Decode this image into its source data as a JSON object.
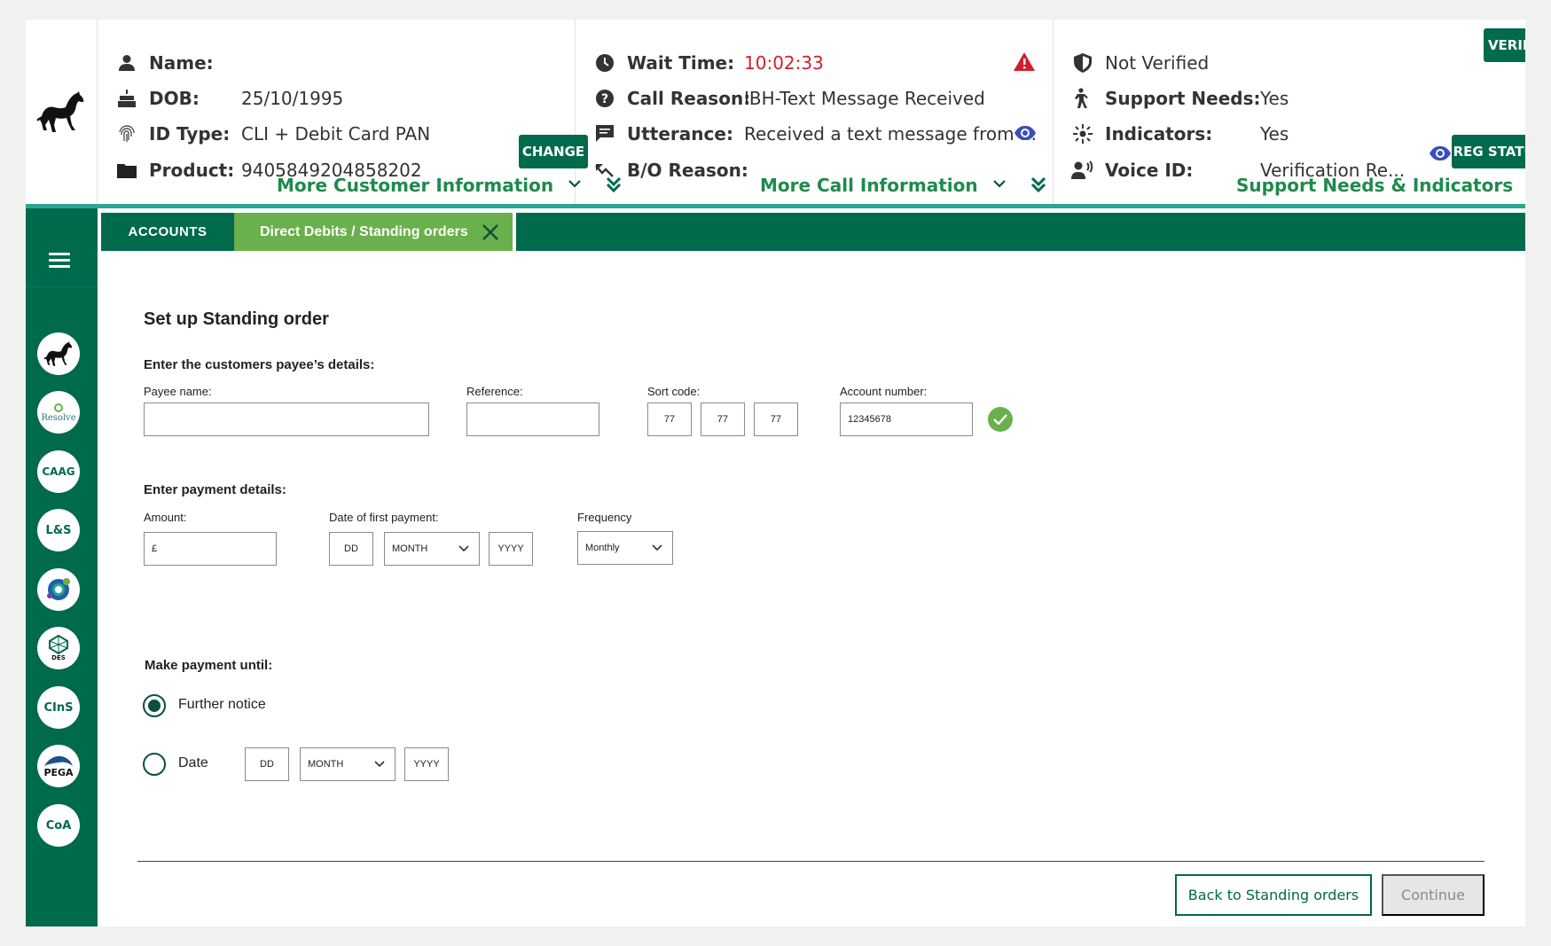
{
  "header": {
    "customer": {
      "name_label": "Name:",
      "name_value": "",
      "dob_label": "DOB:",
      "dob_value": "25/10/1995",
      "idtype_label": "ID Type:",
      "idtype_value": "CLI + Debit Card PAN",
      "product_label": "Product:",
      "product_value": "9405849204858202",
      "change_label": "CHANGE",
      "more_label": "More Customer Information"
    },
    "call": {
      "wait_label": "Wait Time:",
      "wait_value": "10:02:33",
      "reason_label": "Call Reason:",
      "reason_value": "IBH-Text Message Received",
      "utterance_label": "Utterance:",
      "utterance_value": "Received a text message from ...",
      "bo_label": "B/O Reason:",
      "bo_value": "",
      "more_label": "More Call Information"
    },
    "verify": {
      "status_label": "Not Verified",
      "verify_label": "VERIFY",
      "support_label": "Support Needs:",
      "support_value": "Yes",
      "indicators_label": "Indicators:",
      "indicators_value": "Yes",
      "voice_label": "Voice ID:",
      "voice_value": "Verification Re...",
      "reg_label": "REG STATUS",
      "more_label": "Support Needs & Indicators"
    }
  },
  "sidebar": {
    "icons": [
      "horse-icon",
      "resolve-icon",
      "caag-icon",
      "ls-icon",
      "network-icon",
      "des-icon",
      "cins-icon",
      "pega-icon",
      "coa-icon"
    ],
    "labels": {
      "resolve": "Resolve",
      "caag": "CAAG",
      "ls": "L&S",
      "des": "DES",
      "cins": "CInS",
      "pega": "PEGA",
      "coa": "CoA"
    }
  },
  "tabs": [
    {
      "label": "ACCOUNTS"
    },
    {
      "label": "Direct Debits / Standing orders"
    }
  ],
  "form": {
    "title": "Set up Standing order",
    "payee_section": "Enter the customers payee’s details:",
    "payee_name_label": "Payee name:",
    "payee_name_value": "",
    "reference_label": "Reference:",
    "reference_value": "",
    "sort_code_label": "Sort code:",
    "sort_code": [
      "77",
      "77",
      "77"
    ],
    "account_label": "Account number:",
    "account_value": "12345678",
    "payment_section": "Enter payment details:",
    "amount_label": "Amount:",
    "amount_value": "£",
    "first_payment_label": "Date of first payment:",
    "dd_placeholder": "DD",
    "month_placeholder": "MONTH",
    "yyyy_placeholder": "YYYY",
    "frequency_label": "Frequency",
    "frequency_value": "Monthly",
    "until_section": "Make payment until:",
    "opt_further": "Further notice",
    "opt_date": "Date",
    "back_label": "Back to Standing orders",
    "continue_label": "Continue"
  },
  "colors": {
    "brand_green": "#006a4d",
    "light_green": "#6ab04c",
    "teal": "#2aa693",
    "alert_red": "#d0202e",
    "eye_blue": "#3a4fb8"
  }
}
